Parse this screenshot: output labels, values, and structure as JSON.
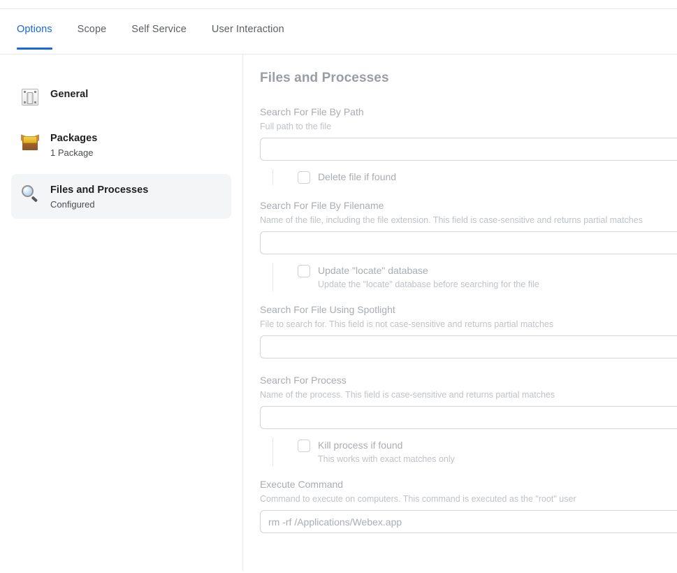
{
  "tabs": [
    {
      "label": "Options",
      "active": true
    },
    {
      "label": "Scope",
      "active": false
    },
    {
      "label": "Self Service",
      "active": false
    },
    {
      "label": "User Interaction",
      "active": false
    }
  ],
  "accent_color": "#1668dc",
  "sidebar": {
    "items": [
      {
        "icon": "light-switch-icon",
        "title": "General",
        "subtitle": "",
        "selected": false
      },
      {
        "icon": "package-box-icon",
        "title": "Packages",
        "subtitle": "1 Package",
        "selected": false
      },
      {
        "icon": "magnifying-glass-icon",
        "title": "Files and Processes",
        "subtitle": "Configured",
        "selected": true
      }
    ]
  },
  "main": {
    "title": "Files and Processes",
    "fields": {
      "search_by_path": {
        "label": "Search For File By Path",
        "help": "Full path to the file",
        "value": "",
        "placeholder": ""
      },
      "delete_if_found": {
        "label": "Delete file if found",
        "checked": false
      },
      "search_by_filename": {
        "label": "Search For File By Filename",
        "help": "Name of the file, including the file extension. This field is case-sensitive and returns partial matches",
        "value": "",
        "placeholder": ""
      },
      "update_locate_db": {
        "label": "Update \"locate\" database",
        "help": "Update the \"locate\" database before searching for the file",
        "checked": false
      },
      "search_spotlight": {
        "label": "Search For File Using Spotlight",
        "help": "File to search for. This field is not case-sensitive and returns partial matches",
        "value": "",
        "placeholder": ""
      },
      "search_process": {
        "label": "Search For Process",
        "help": "Name of the process. This field is case-sensitive and returns partial matches",
        "value": "",
        "placeholder": ""
      },
      "kill_process": {
        "label": "Kill process if found",
        "help": "This works with exact matches only",
        "checked": false
      },
      "execute_command": {
        "label": "Execute Command",
        "help": "Command to execute on computers. This command is executed as the \"root\" user",
        "value": "rm -rf /Applications/Webex.app",
        "placeholder": ""
      }
    }
  }
}
